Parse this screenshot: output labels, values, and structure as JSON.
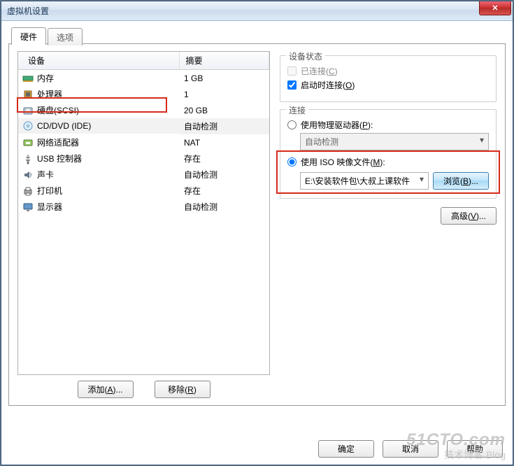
{
  "window": {
    "title": "虚拟机设置"
  },
  "tabs": {
    "hardware": "硬件",
    "options": "选项"
  },
  "columns": {
    "device": "设备",
    "summary": "摘要"
  },
  "devices": [
    {
      "icon": "memory",
      "name": "内存",
      "summary": "1 GB"
    },
    {
      "icon": "cpu",
      "name": "处理器",
      "summary": "1"
    },
    {
      "icon": "disk",
      "name": "硬盘(SCSI)",
      "summary": "20 GB"
    },
    {
      "icon": "cd",
      "name": "CD/DVD (IDE)",
      "summary": "自动检测"
    },
    {
      "icon": "nic",
      "name": "网络适配器",
      "summary": "NAT"
    },
    {
      "icon": "usb",
      "name": "USB 控制器",
      "summary": "存在"
    },
    {
      "icon": "sound",
      "name": "声卡",
      "summary": "自动检测"
    },
    {
      "icon": "printer",
      "name": "打印机",
      "summary": "存在"
    },
    {
      "icon": "display",
      "name": "显示器",
      "summary": "自动检测"
    }
  ],
  "buttons": {
    "add": "添加(A)...",
    "remove": "移除(R)",
    "browse": "浏览(B)...",
    "advanced": "高级(V)...",
    "ok": "确定",
    "cancel": "取消",
    "help": "帮助"
  },
  "status_group": {
    "legend": "设备状态",
    "connected": "已连接(C)",
    "poweron": "启动时连接(O)"
  },
  "connect_group": {
    "legend": "连接",
    "use_physical": "使用物理驱动器(P):",
    "physical_combo": "自动检测",
    "use_iso": "使用 ISO 映像文件(M):",
    "iso_path": "E:\\安装软件包\\大叔上课软件"
  },
  "watermark": {
    "line1": "51CTO.com",
    "line2": "技术博客  Blog"
  }
}
